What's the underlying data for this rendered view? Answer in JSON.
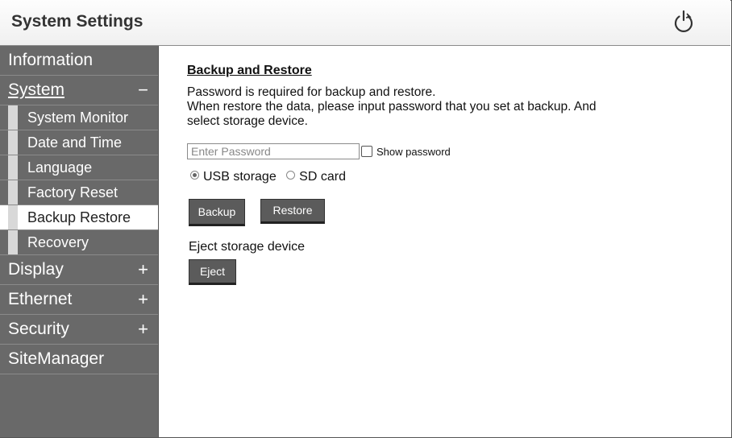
{
  "header": {
    "title": "System Settings",
    "power_icon": "power-icon"
  },
  "sidebar": {
    "information": "Information",
    "system": {
      "label": "System",
      "sign": "−"
    },
    "system_items": [
      "System Monitor",
      "Date and Time",
      "Language",
      "Factory Reset",
      "Backup Restore",
      "Recovery"
    ],
    "active_item": "Backup Restore",
    "display": {
      "label": "Display",
      "sign": "+"
    },
    "ethernet": {
      "label": "Ethernet",
      "sign": "+"
    },
    "security": {
      "label": "Security",
      "sign": "+"
    },
    "sitemanager": "SiteManager"
  },
  "main": {
    "title": "Backup and Restore",
    "desc_line1": "Password is required for backup and restore.",
    "desc_line2": "When restore the data, please input password that you set at backup. And",
    "desc_line3": "select storage device.",
    "password_placeholder": "Enter Password",
    "show_password_label": "Show password",
    "storage_options": [
      {
        "label": "USB storage",
        "selected": true
      },
      {
        "label": "SD card",
        "selected": false
      }
    ],
    "backup_label": "Backup",
    "restore_label": "Restore",
    "eject_section_label": "Eject storage device",
    "eject_label": "Eject"
  },
  "colors": {
    "sidebar_bg": "#696969",
    "button_bg": "#5b5b5b",
    "active_item_bg": "#ffffff"
  }
}
